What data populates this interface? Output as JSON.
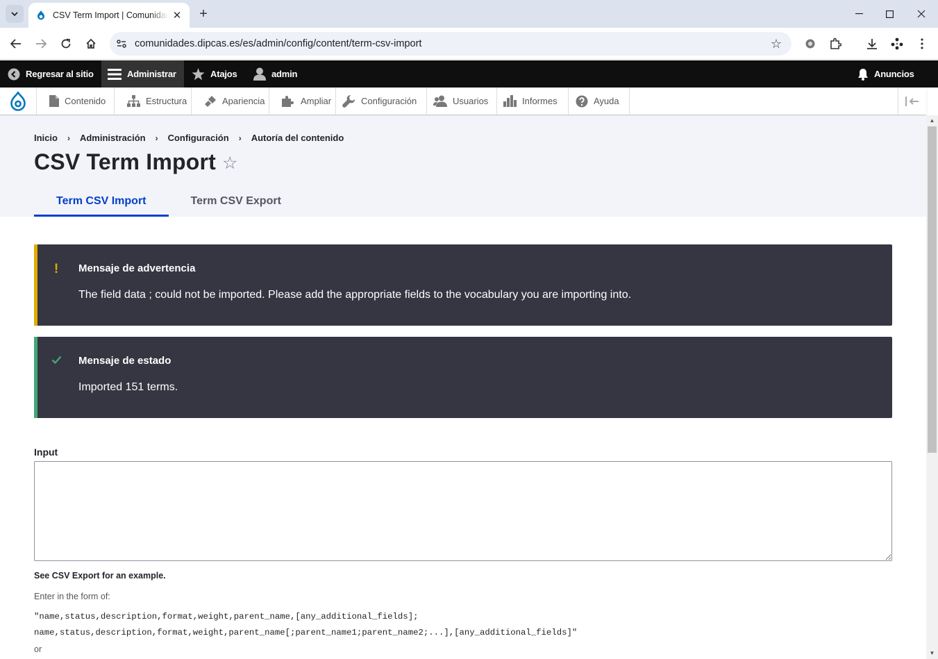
{
  "browser": {
    "tab_title": "CSV Term Import | Comunidades",
    "url": "comunidades.dipcas.es/es/admin/config/content/term-csv-import"
  },
  "toolbar": {
    "back_to_site": "Regresar al sitio",
    "manage": "Administrar",
    "shortcuts": "Atajos",
    "user": "admin",
    "announcements": "Anuncios"
  },
  "tray": {
    "items": [
      {
        "label": "Contenido",
        "icon": "file-icon"
      },
      {
        "label": "Estructura",
        "icon": "sitemap-icon"
      },
      {
        "label": "Apariencia",
        "icon": "paintbrush-icon"
      },
      {
        "label": "Ampliar",
        "icon": "puzzle-icon"
      },
      {
        "label": "Configuración",
        "icon": "wrench-icon"
      },
      {
        "label": "Usuarios",
        "icon": "people-icon"
      },
      {
        "label": "Informes",
        "icon": "bar-chart-icon"
      },
      {
        "label": "Ayuda",
        "icon": "help-icon"
      }
    ]
  },
  "breadcrumb": [
    "Inicio",
    "Administración",
    "Configuración",
    "Autoría del contenido"
  ],
  "page": {
    "title": "CSV Term Import",
    "tabs": [
      {
        "label": "Term CSV Import",
        "active": true
      },
      {
        "label": "Term CSV Export",
        "active": false
      }
    ]
  },
  "messages": {
    "warning": {
      "title": "Mensaje de advertencia",
      "text": "The field data ; could not be imported. Please add the appropriate fields to the vocabulary you are importing into.",
      "color": "#e0ac00"
    },
    "status": {
      "title": "Mensaje de estado",
      "text": "Imported 151 terms.",
      "color": "#42a877"
    }
  },
  "form": {
    "input_label": "Input",
    "input_value": "",
    "see_export": "See CSV Export for an example.",
    "enter_form": "Enter in the form of:",
    "format_line1": "\"name,status,description,format,weight,parent_name,[any_additional_fields];",
    "format_line2": "name,status,description,format,weight,parent_name[;parent_name1;parent_name2;...],[any_additional_fields]\"",
    "or": "or"
  },
  "colors": {
    "accent": "#003ecc",
    "toolbar_bg": "#0f0f0f",
    "message_bg": "#353641"
  }
}
